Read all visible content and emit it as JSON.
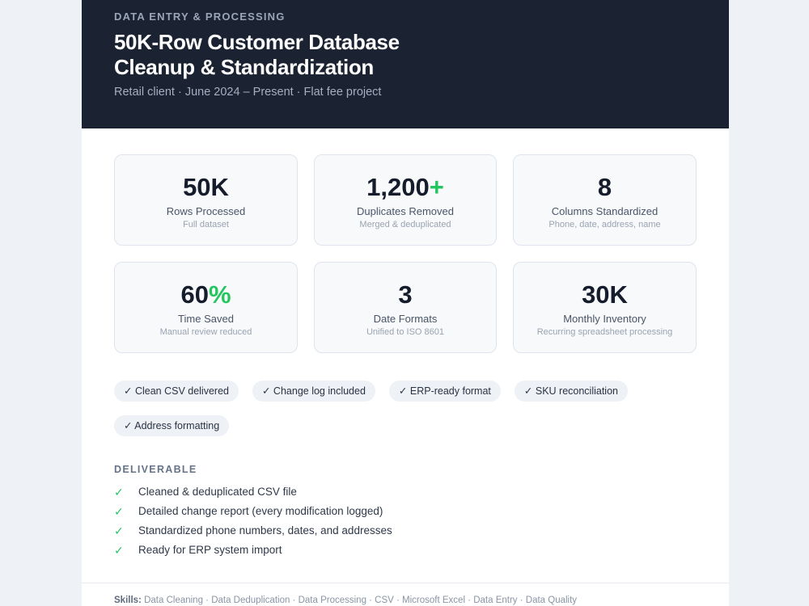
{
  "header": {
    "category": "DATA ENTRY & PROCESSING",
    "title_line1": "50K-Row Customer Database",
    "title_line2": "Cleanup & Standardization",
    "meta": "Retail client · June 2024 – Present · Flat fee project"
  },
  "stats": [
    {
      "value": "50K",
      "accent": "",
      "label": "Rows Processed",
      "sub": "Full dataset"
    },
    {
      "value": "1,200",
      "accent": "+",
      "label": "Duplicates Removed",
      "sub": "Merged & deduplicated"
    },
    {
      "value": "8",
      "accent": "",
      "label": "Columns Standardized",
      "sub": "Phone, date, address, name"
    },
    {
      "value": "60",
      "accent": "%",
      "label": "Time Saved",
      "sub": "Manual review reduced"
    },
    {
      "value": "3",
      "accent": "",
      "label": "Date Formats",
      "sub": "Unified to ISO 8601"
    },
    {
      "value": "30K",
      "accent": "",
      "label": "Monthly Inventory",
      "sub": "Recurring spreadsheet processing"
    }
  ],
  "tags": [
    "✓ Clean CSV delivered",
    "✓ Change log included",
    "✓ ERP-ready format",
    "✓ SKU reconciliation",
    "✓ Address formatting"
  ],
  "deliverable": {
    "title": "DELIVERABLE",
    "check_glyph": "✓",
    "items": [
      "Cleaned & deduplicated CSV file",
      "Detailed change report (every modification logged)",
      "Standardized phone numbers, dates, and addresses",
      "Ready for ERP system import"
    ]
  },
  "skills": {
    "label": "Skills:",
    "list": "Data Cleaning · Data Deduplication · Data Processing · CSV · Microsoft Excel · Data Entry · Data Quality"
  },
  "colors": {
    "header_bg": "#1b2231",
    "accent_green": "#22c55e",
    "page_bg": "#eef1f6"
  }
}
